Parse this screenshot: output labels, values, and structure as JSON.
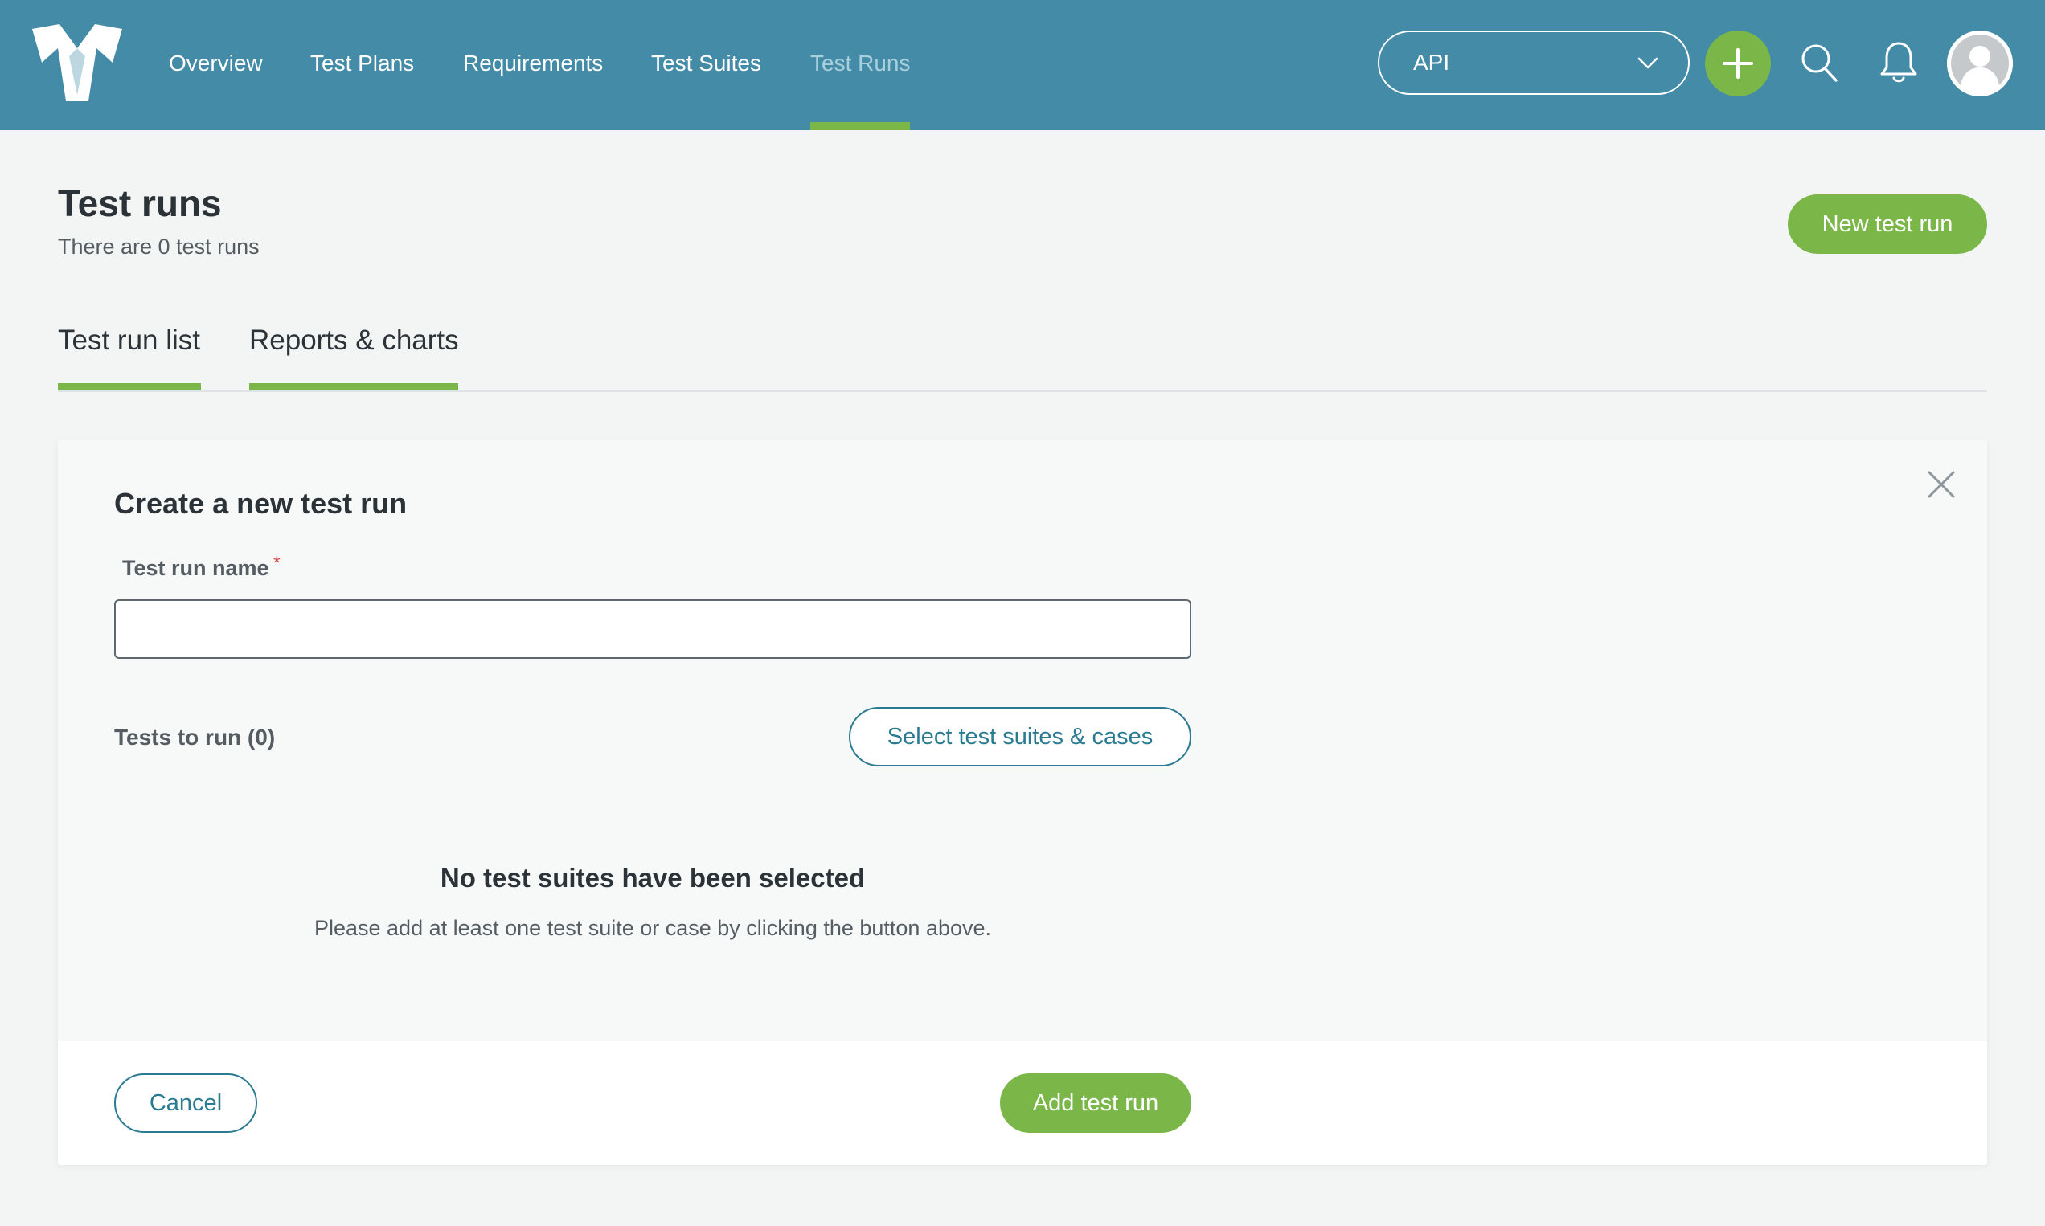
{
  "nav": {
    "items": [
      {
        "label": "Overview"
      },
      {
        "label": "Test Plans"
      },
      {
        "label": "Requirements"
      },
      {
        "label": "Test Suites"
      },
      {
        "label": "Test Runs",
        "active": true
      }
    ],
    "project": "API"
  },
  "header": {
    "title": "Test runs",
    "subtitle": "There are 0 test runs",
    "new_button": "New test run"
  },
  "tabs": [
    {
      "label": "Test run list"
    },
    {
      "label": "Reports & charts"
    }
  ],
  "form": {
    "title": "Create a new test run",
    "name_label": "Test run name",
    "required_mark": "*",
    "name_value": "",
    "tests_label": "Tests to run (0)",
    "select_button": "Select test suites & cases",
    "empty_title": "No test suites have been selected",
    "empty_text": "Please add at least one test suite or case by clicking the button above.",
    "cancel_button": "Cancel",
    "submit_button": "Add test run"
  },
  "colors": {
    "topbar": "#438ba7",
    "accent_green": "#7ab648",
    "outline_teal": "#2a7b91"
  },
  "icons": [
    "app-logo-icon",
    "chevron-down-icon",
    "plus-icon",
    "search-icon",
    "bell-icon",
    "user-avatar-icon",
    "close-icon"
  ]
}
